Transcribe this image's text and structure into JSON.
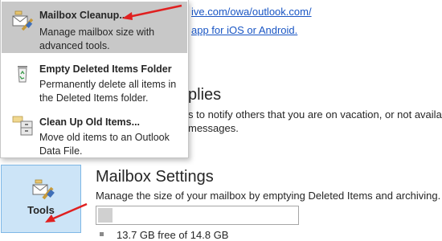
{
  "background": {
    "link_1": "ive.com/owa/outlook.com/",
    "link_2": "app for iOS or Android.",
    "auto_replies_heading": "plies",
    "auto_replies_desc_1": "s to notify others that you are on vacation, or not available",
    "auto_replies_desc_2": "messages."
  },
  "menu": {
    "items": [
      {
        "title": "Mailbox Cleanup...",
        "desc": "Manage mailbox size with advanced tools.",
        "icon": "mailbox-cleanup-icon",
        "highlighted": true
      },
      {
        "title": "Empty Deleted Items Folder",
        "desc": "Permanently delete all items in the Deleted Items folder.",
        "icon": "recycle-bin-icon",
        "highlighted": false
      },
      {
        "title": "Clean Up Old Items...",
        "desc": "Move old items to an Outlook Data File.",
        "icon": "archive-cabinet-icon",
        "highlighted": false
      }
    ]
  },
  "tools_button": {
    "label": "Tools",
    "icon": "tools-icon"
  },
  "mailbox_settings": {
    "heading": "Mailbox Settings",
    "description": "Manage the size of your mailbox by emptying Deleted Items and archiving.",
    "usage_fraction": 0.07,
    "free_text": "13.7 GB free of 14.8 GB"
  },
  "colors": {
    "link": "#1a56c4",
    "highlight": "#c8c8c8",
    "tools_bg": "#cce4f7",
    "arrow": "#e02020"
  }
}
